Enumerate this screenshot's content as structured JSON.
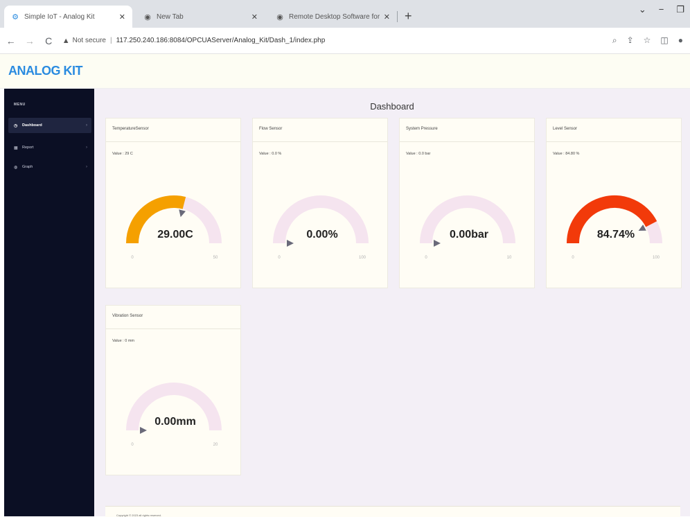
{
  "browser": {
    "tabs": [
      {
        "title": "Simple IoT - Analog Kit",
        "icon": "app-icon",
        "active": true
      },
      {
        "title": "New Tab",
        "icon": "chrome-icon",
        "active": false
      },
      {
        "title": "Remote Desktop Software for Wi",
        "icon": "chrome-icon",
        "active": false
      }
    ],
    "security_label": "Not secure",
    "url": "117.250.240.186:8084/OPCUAServer/Analog_Kit/Dash_1/index.php"
  },
  "app": {
    "brand": "ANALOG KIT"
  },
  "sidebar": {
    "menu_title": "MENU",
    "items": [
      {
        "label": "Dashboard",
        "icon": "dashboard-icon",
        "active": true
      },
      {
        "label": "Report",
        "icon": "report-icon",
        "active": false
      },
      {
        "label": "Graph",
        "icon": "graph-icon",
        "active": false
      }
    ]
  },
  "page": {
    "title": "Dashboard"
  },
  "gauges": [
    {
      "title": "TemperatureSensor",
      "value_text": "Value : 29 C",
      "display": "29.00C",
      "min": "0",
      "max": "50",
      "fraction": 0.58,
      "color": "#f5a000"
    },
    {
      "title": "Flow Sensor",
      "value_text": "Value : 0.0 %",
      "display": "0.00%",
      "min": "0",
      "max": "100",
      "fraction": 0,
      "color": "#f5a000"
    },
    {
      "title": "System Pressure",
      "value_text": "Value : 0.0 bar",
      "display": "0.00bar",
      "min": "0",
      "max": "10",
      "fraction": 0,
      "color": "#f5a000"
    },
    {
      "title": "Level Sensor",
      "value_text": "Value : 84.80 %",
      "display": "84.74%",
      "min": "0",
      "max": "100",
      "fraction": 0.8474,
      "color": "#f23a0a"
    },
    {
      "title": "Vibration Sensor",
      "value_text": "Value : 0 mm",
      "display": "0.00mm",
      "min": "0",
      "max": "20",
      "fraction": 0,
      "color": "#f5a000"
    }
  ],
  "footer": {
    "text": "Copyright © 2023 all rights reserved."
  },
  "colors": {
    "accent": "#2a8be0",
    "sidebar": "#0b0f24",
    "track": "#f5e4ef",
    "needle": "#6a6a7a"
  }
}
